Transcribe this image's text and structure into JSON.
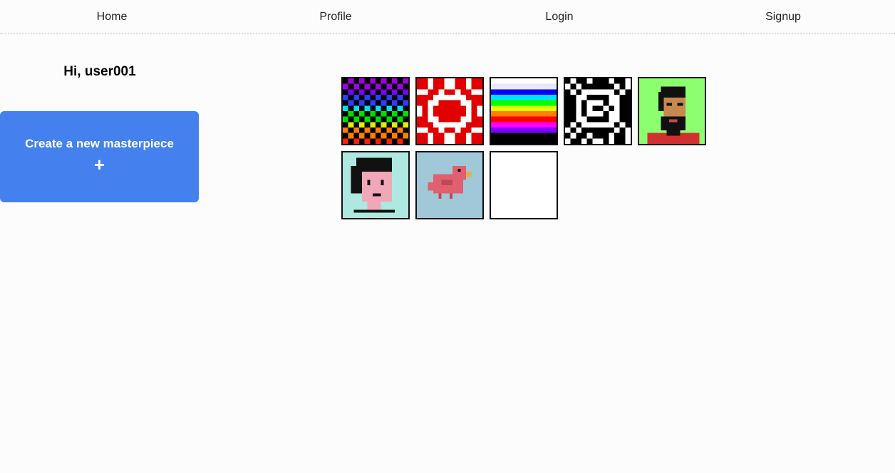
{
  "nav": {
    "items": [
      "Home",
      "Profile",
      "Login",
      "Signup"
    ]
  },
  "greeting": "Hi, user001",
  "create_button": {
    "label": "Create a new masterpiece",
    "icon": "+"
  },
  "colors": {
    "accent": "#4480ee",
    "background": "#fcfcfc"
  },
  "artworks": [
    {
      "name": "rainbow-checkerboard"
    },
    {
      "name": "red-white-quilt"
    },
    {
      "name": "rainbow-stripes"
    },
    {
      "name": "black-white-eye"
    },
    {
      "name": "bearded-man-portrait"
    },
    {
      "name": "black-hair-boy-portrait"
    },
    {
      "name": "pink-bird"
    },
    {
      "name": "blank-canvas"
    }
  ]
}
